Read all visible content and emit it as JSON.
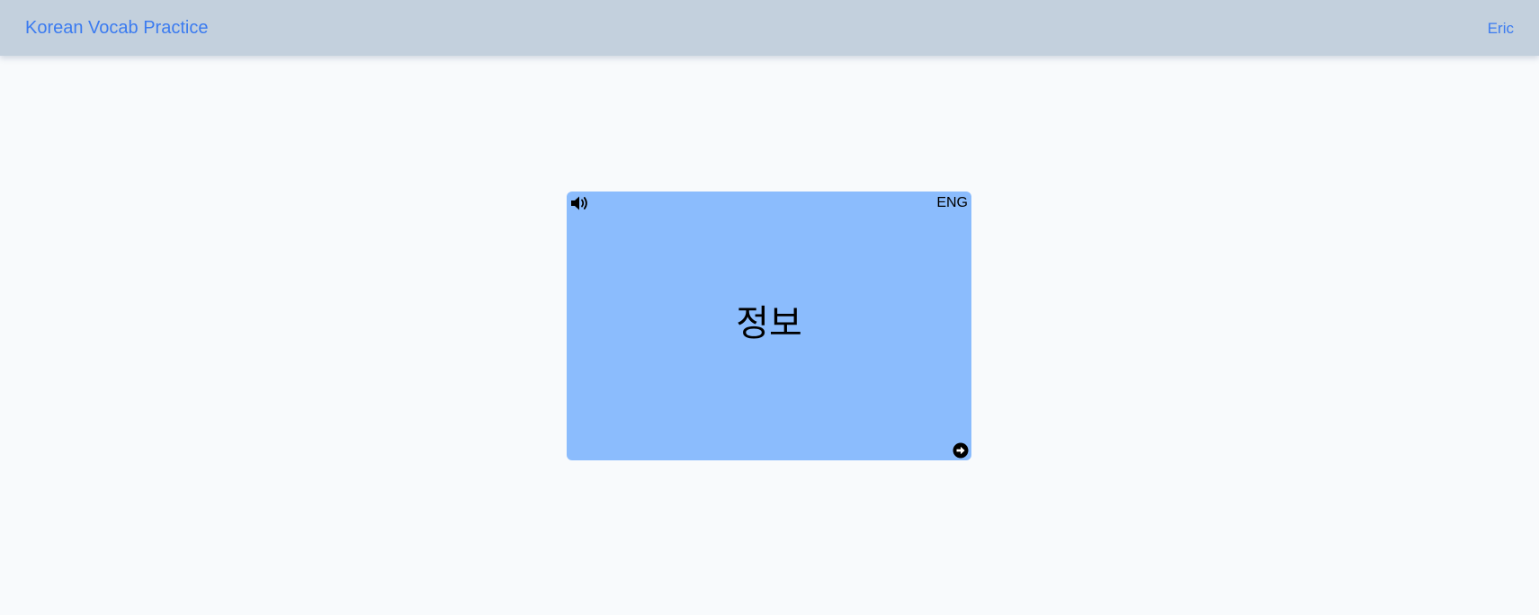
{
  "navbar": {
    "brand": "Korean Vocab Practice",
    "user": "Eric",
    "link_color": "#3b7bf0",
    "background": "#c3d0dd"
  },
  "flashcard": {
    "word": "정보",
    "language_toggle": "ENG",
    "background": "#8bbcfd",
    "sound_icon": "speaker-volume-icon",
    "next_icon": "arrow-circle-right-icon"
  }
}
